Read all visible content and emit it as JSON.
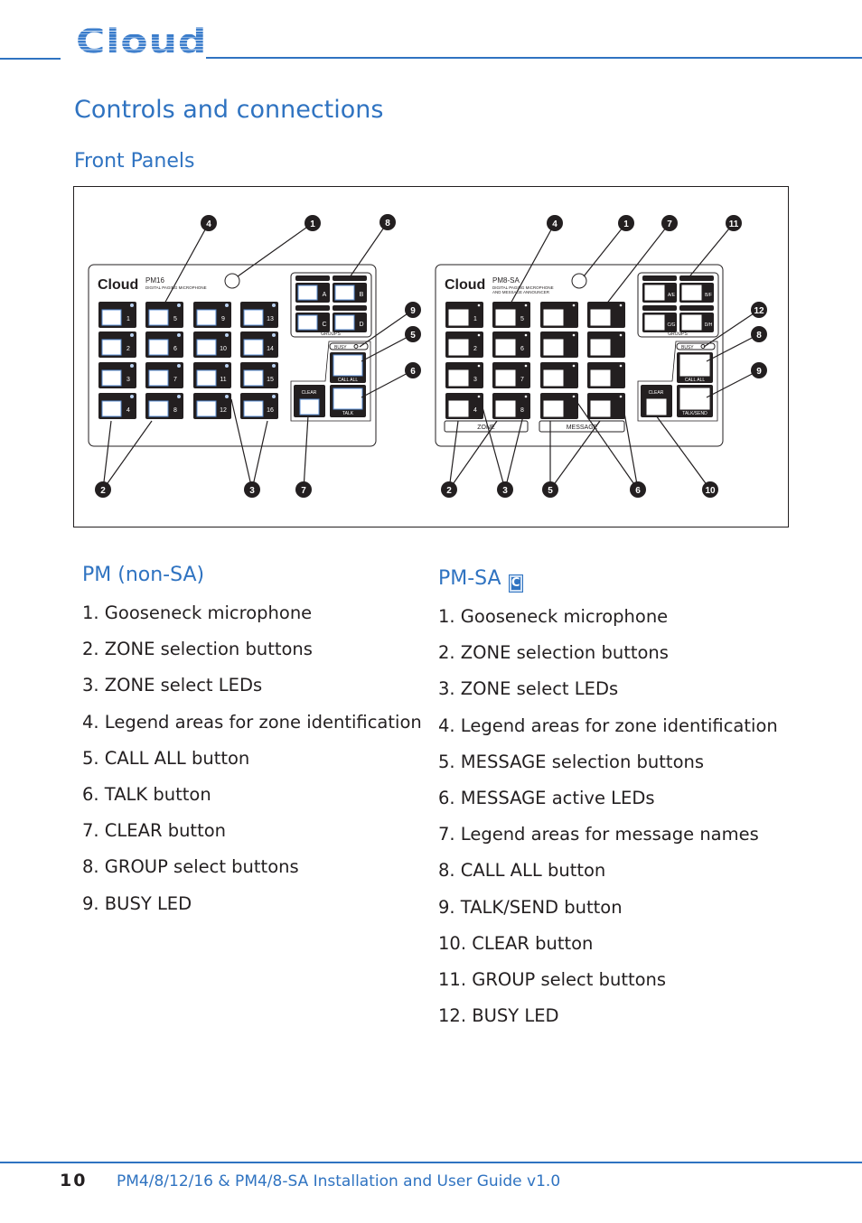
{
  "header": {
    "logo": "Cloud",
    "title": "Controls and connections",
    "subtitle": "Front Panels"
  },
  "colors": {
    "accent": "#2f73c1",
    "panel_button": "#231f20",
    "button_face_outline": "#5b8fd6"
  },
  "diagram": {
    "left_panel": {
      "brand": "Cloud",
      "model": "PM16",
      "description": "DIGITAL PAGING MICROPHONE",
      "zone_numbers": [
        "1",
        "2",
        "3",
        "4",
        "5",
        "6",
        "7",
        "8",
        "9",
        "10",
        "11",
        "12",
        "13",
        "14",
        "15",
        "16"
      ],
      "groups": [
        "A",
        "B",
        "C",
        "D"
      ],
      "groups_label": "GROUPS",
      "busy": "BUSY",
      "call_all": "CALL ALL",
      "talk": "TALK",
      "clear": "CLEAR",
      "callouts": [
        "4",
        "1",
        "8",
        "9",
        "5",
        "6",
        "2",
        "3",
        "7"
      ]
    },
    "right_panel": {
      "brand": "Cloud",
      "model": "PM8-SA",
      "description": "DIGITAL PAGING MICROPHONE",
      "description2": "AND MESSAGE ANNOUNCER",
      "zone_numbers": [
        "1",
        "2",
        "3",
        "4",
        "5",
        "6",
        "7",
        "8"
      ],
      "groups": [
        "A/E",
        "B/F",
        "C/G",
        "D/H"
      ],
      "groups_label": "GROUPS",
      "zone_label": "ZONE",
      "message_label": "MESSAGE",
      "busy": "BUSY",
      "call_all": "CALL ALL",
      "talk": "TALK/SEND",
      "clear": "CLEAR",
      "callouts": [
        "4",
        "1",
        "7",
        "11",
        "12",
        "8",
        "9",
        "2",
        "3",
        "5",
        "6",
        "10"
      ]
    }
  },
  "pm_non_sa": {
    "heading": "PM (non-SA)",
    "items": [
      "1. Gooseneck microphone",
      "2. ZONE selection buttons",
      "3. ZONE select LEDs",
      "4. Legend areas for zone identification",
      "5. CALL ALL button",
      "6. TALK button",
      "7. CLEAR button",
      "8. GROUP select buttons",
      "9. BUSY LED"
    ]
  },
  "pm_sa": {
    "heading": "PM-SA",
    "icon": "cloud-c-logo-icon",
    "items": [
      "1. Gooseneck microphone",
      "2. ZONE selection buttons",
      "3. ZONE select LEDs",
      "4. Legend areas for zone identification",
      "5. MESSAGE selection buttons",
      "6. MESSAGE active LEDs",
      "7. Legend areas for message names",
      "8. CALL ALL button",
      "9. TALK/SEND button",
      "10. CLEAR button",
      "11. GROUP select buttons",
      "12. BUSY LED"
    ]
  },
  "footer": {
    "page_number": "10",
    "title": "PM4/8/12/16 & PM4/8-SA Installation and User Guide v1.0"
  }
}
